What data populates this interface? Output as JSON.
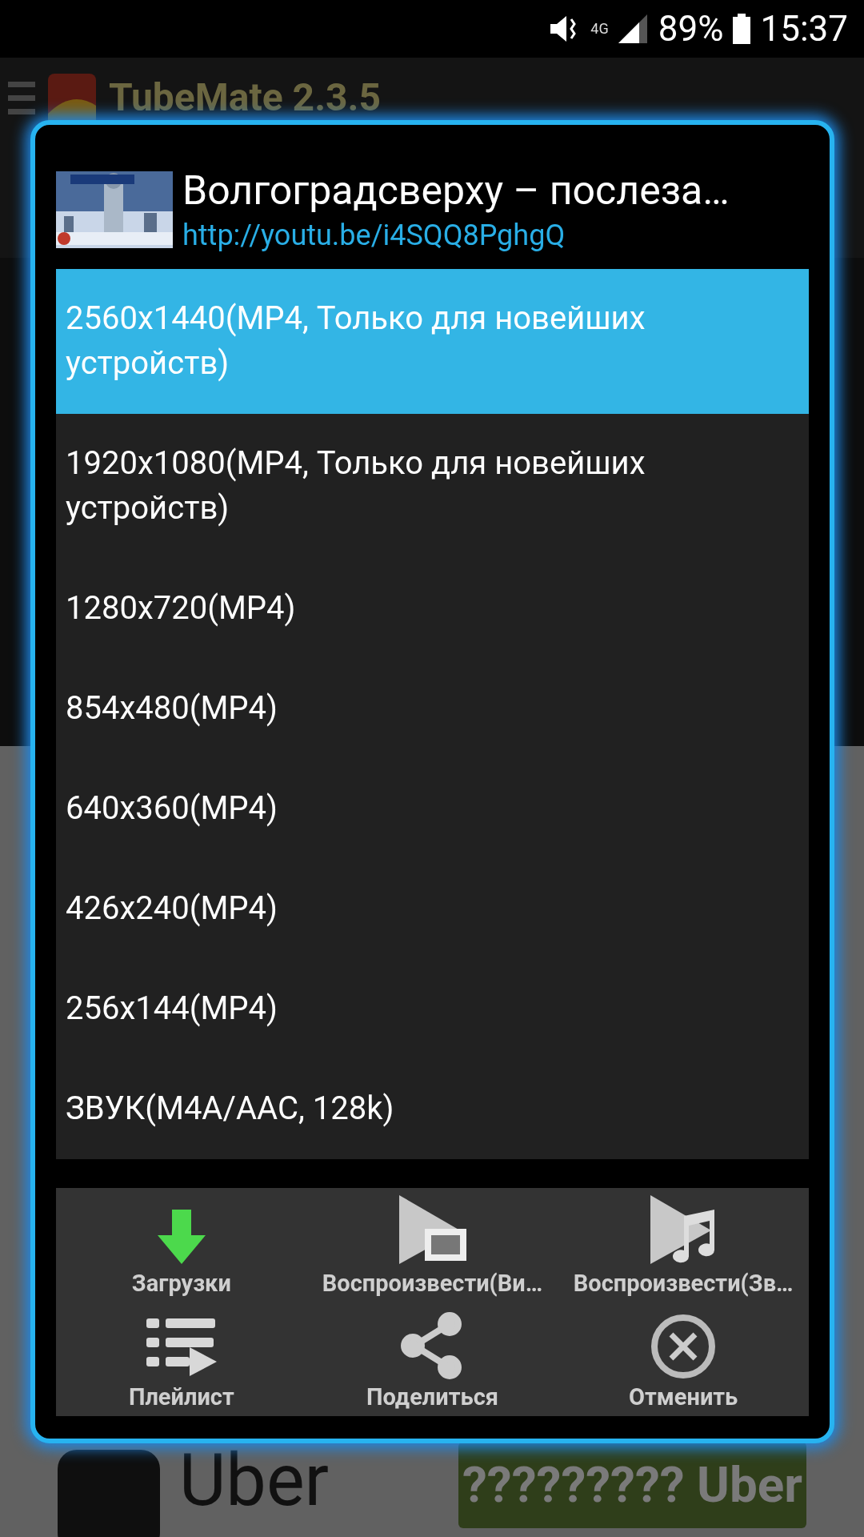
{
  "status_bar": {
    "battery": "89%",
    "time": "15:37",
    "network": "4G"
  },
  "app_bar": {
    "title": "TubeMate 2.3.5"
  },
  "ad": {
    "brand": "Uber",
    "button": "????????? Uber"
  },
  "dialog": {
    "title": "Волгоградсверху – послеза…",
    "url": "http://youtu.be/i4SQQ8PghgQ",
    "formats": [
      {
        "label": "2560x1440(MP4, Только для новейших устройств)",
        "selected": true
      },
      {
        "label": "1920x1080(MP4, Только для новейших устройств)",
        "selected": false
      },
      {
        "label": "1280x720(MP4)",
        "selected": false
      },
      {
        "label": "854x480(MP4)",
        "selected": false
      },
      {
        "label": "640x360(MP4)",
        "selected": false
      },
      {
        "label": "426x240(MP4)",
        "selected": false
      },
      {
        "label": "256x144(MP4)",
        "selected": false
      },
      {
        "label": "ЗВУК(M4A/AAC, 128k)",
        "selected": false
      }
    ],
    "actions": [
      {
        "kind": "download",
        "label": "Загрузки"
      },
      {
        "kind": "play-video",
        "label": "Воспроизвести(Ви…"
      },
      {
        "kind": "play-audio",
        "label": "Воспроизвести(Зв…"
      },
      {
        "kind": "playlist",
        "label": "Плейлист"
      },
      {
        "kind": "share",
        "label": "Поделиться"
      },
      {
        "kind": "cancel",
        "label": "Отменить"
      }
    ]
  }
}
